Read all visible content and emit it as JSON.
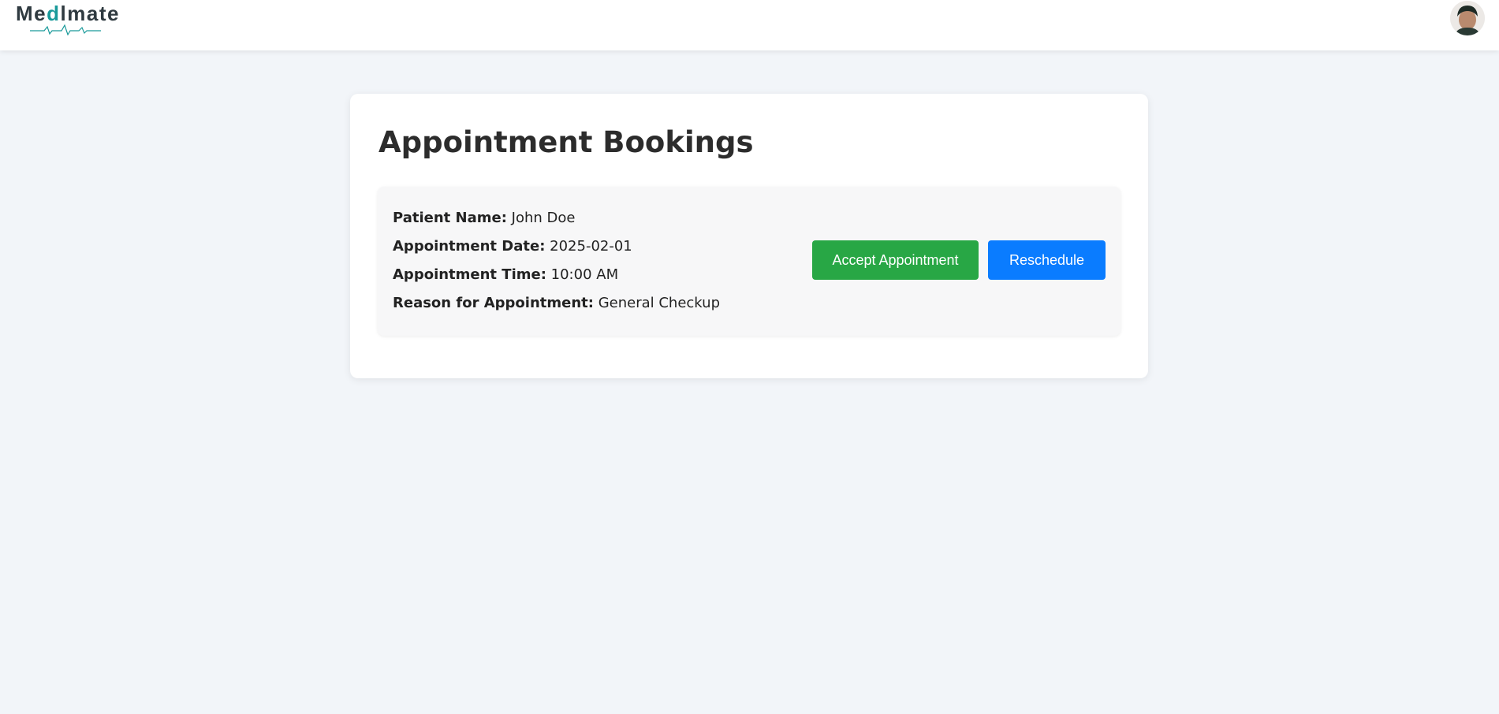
{
  "header": {
    "logo": {
      "prefix": "Me",
      "accent": "d",
      "suffix": "lmate"
    },
    "colors": {
      "logo_text": "#2f3a40",
      "logo_accent": "#1a9a9a"
    }
  },
  "page": {
    "title": "Appointment Bookings"
  },
  "bookings": [
    {
      "patient_name": {
        "label": "Patient Name:",
        "value": "John Doe"
      },
      "date": {
        "label": "Appointment Date:",
        "value": "2025-02-01"
      },
      "time": {
        "label": "Appointment Time:",
        "value": "10:00 AM"
      },
      "reason": {
        "label": "Reason for Appointment:",
        "value": "General Checkup"
      },
      "accept_label": "Accept Appointment",
      "reschedule_label": "Reschedule"
    }
  ],
  "colors": {
    "background": "#f2f5f9",
    "accept": "#28a745",
    "reschedule": "#0a7cff"
  }
}
